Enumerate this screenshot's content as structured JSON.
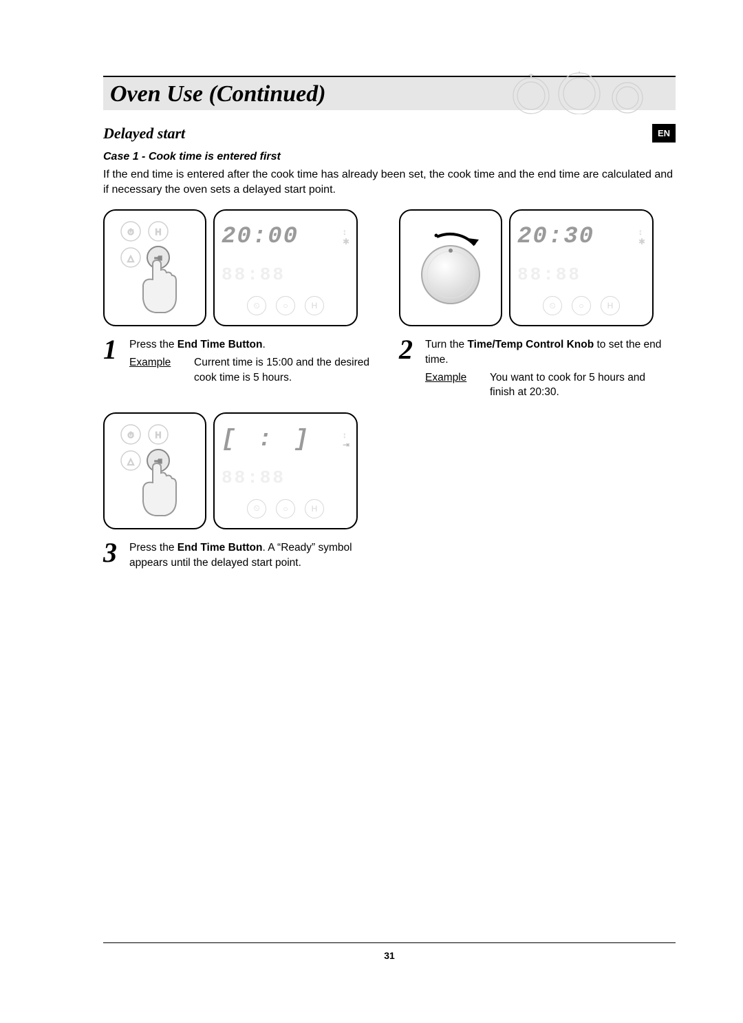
{
  "header": {
    "title": "Oven Use (Continued)",
    "lang_badge": "EN"
  },
  "section": {
    "heading": "Delayed start",
    "case_title": "Case 1 - Cook time is entered first",
    "intro": "If the end time is entered after the cook time has already been set, the cook time and the end time are calculated and if necessary the oven sets a delayed start point."
  },
  "steps": {
    "s1": {
      "num": "1",
      "line_pre": "Press the ",
      "bold": "End Time Button",
      "line_post": ".",
      "example_label": "Example",
      "example_text": "Current time is 15:00 and the desired cook time is 5 hours.",
      "display": "20:00",
      "ghost": "88:88"
    },
    "s2": {
      "num": "2",
      "line_pre": "Turn the ",
      "bold": "Time/Temp Control Knob",
      "line_post": " to set the end time.",
      "example_label": "Example",
      "example_text": "You want to cook for 5 hours and finish at 20:30.",
      "display": "20:30",
      "ghost": "88:88"
    },
    "s3": {
      "num": "3",
      "line_pre": "Press the ",
      "bold": "End Time Button",
      "line_post": ". A “Ready” symbol appears until the delayed start point.",
      "display": "[ : ] ",
      "ghost": "88:88"
    }
  },
  "icons": {
    "mini1": "⏲",
    "mini2": "○",
    "mini3": "H",
    "seg_top": "↕",
    "seg_bot": "✱"
  },
  "page_number": "31"
}
